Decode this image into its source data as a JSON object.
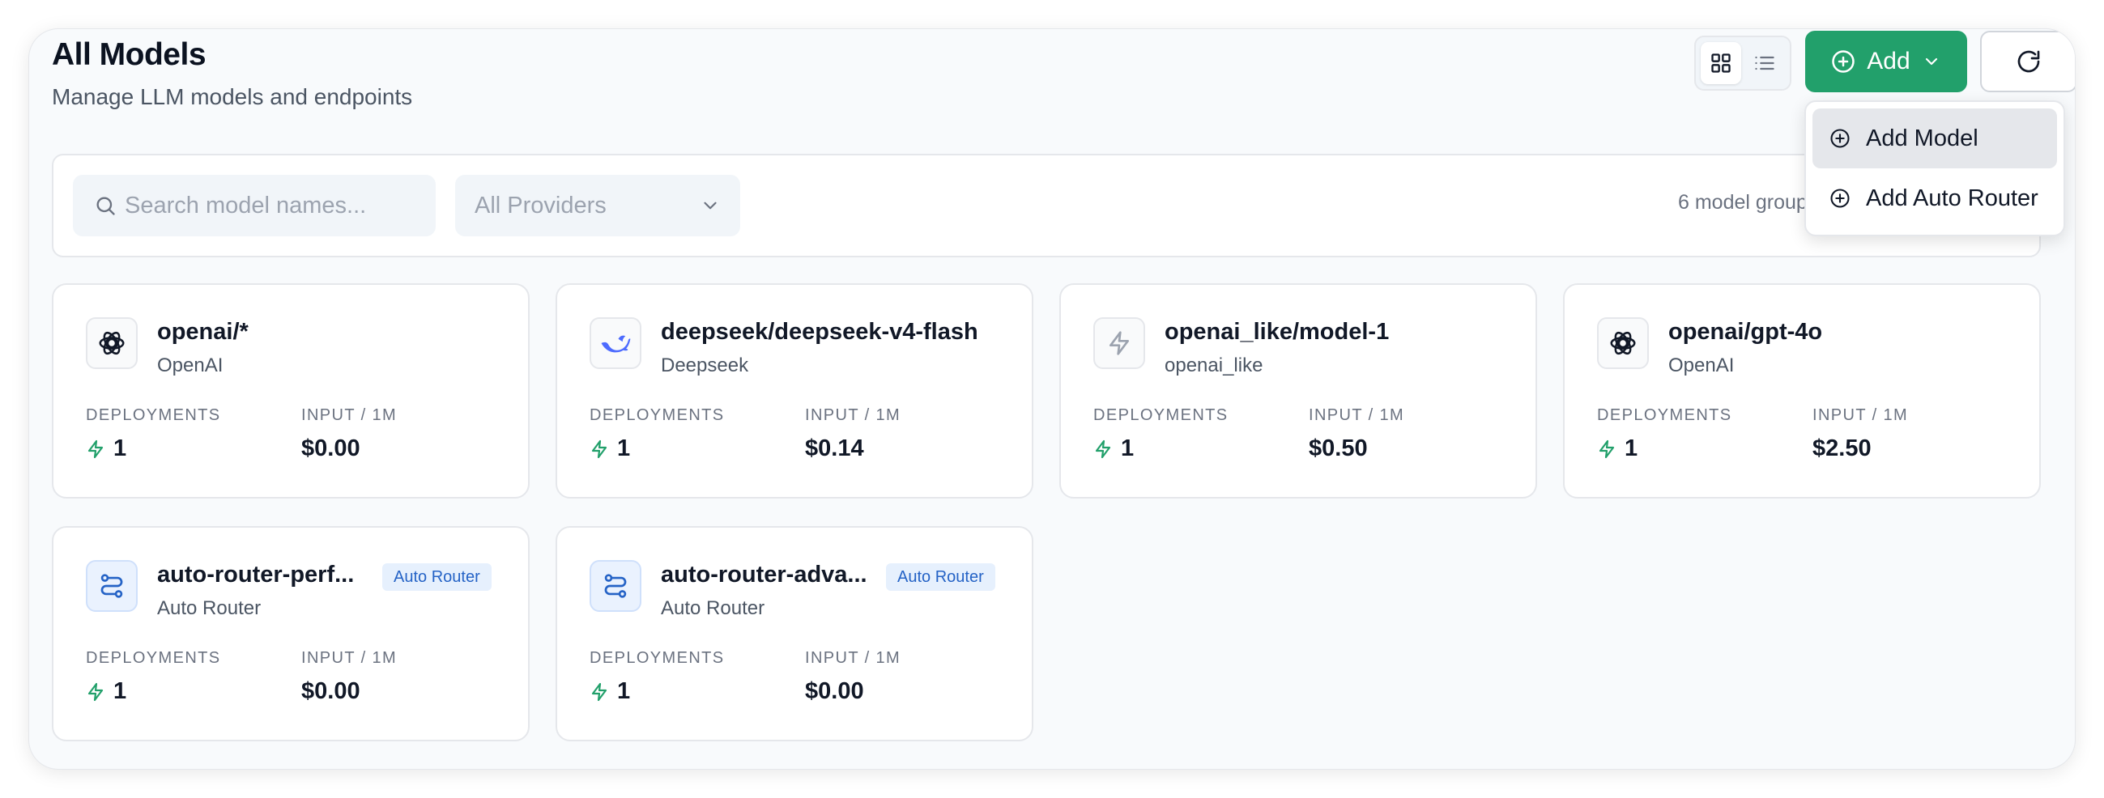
{
  "header": {
    "title": "All Models",
    "subtitle": "Manage LLM models and endpoints"
  },
  "toolbar": {
    "add_label": "Add",
    "view_modes": [
      "grid",
      "list"
    ],
    "active_view": "grid"
  },
  "add_menu": {
    "items": [
      {
        "label": "Add Model",
        "icon": "plus-circle-icon"
      },
      {
        "label": "Add Auto Router",
        "icon": "plus-circle-icon"
      }
    ]
  },
  "filters": {
    "search_placeholder": "Search model names...",
    "provider_selected": "All Providers",
    "groups_count_text": "6 model groups"
  },
  "cards": [
    {
      "name": "openai/*",
      "provider": "OpenAI",
      "icon": "openai-logo-icon",
      "badge": "",
      "deployments_label": "DEPLOYMENTS",
      "deployments": "1",
      "price_label": "INPUT / 1M",
      "price": "$0.00"
    },
    {
      "name": "deepseek/deepseek-v4-flash",
      "provider": "Deepseek",
      "icon": "deepseek-logo-icon",
      "badge": "",
      "deployments_label": "DEPLOYMENTS",
      "deployments": "1",
      "price_label": "INPUT / 1M",
      "price": "$0.14"
    },
    {
      "name": "openai_like/model-1",
      "provider": "openai_like",
      "icon": "lightning-icon",
      "badge": "",
      "deployments_label": "DEPLOYMENTS",
      "deployments": "1",
      "price_label": "INPUT / 1M",
      "price": "$0.50"
    },
    {
      "name": "openai/gpt-4o",
      "provider": "OpenAI",
      "icon": "openai-logo-icon",
      "badge": "",
      "deployments_label": "DEPLOYMENTS",
      "deployments": "1",
      "price_label": "INPUT / 1M",
      "price": "$2.50"
    },
    {
      "name": "auto-router-perf...",
      "provider": "Auto Router",
      "icon": "router-icon",
      "badge": "Auto Router",
      "deployments_label": "DEPLOYMENTS",
      "deployments": "1",
      "price_label": "INPUT / 1M",
      "price": "$0.00"
    },
    {
      "name": "auto-router-adva...",
      "provider": "Auto Router",
      "icon": "router-icon",
      "badge": "Auto Router",
      "deployments_label": "DEPLOYMENTS",
      "deployments": "1",
      "price_label": "INPUT / 1M",
      "price": "$0.00"
    }
  ],
  "colors": {
    "accent": "#22a06b",
    "badge_bg": "#e6f0fd",
    "badge_text": "#2563c6"
  }
}
